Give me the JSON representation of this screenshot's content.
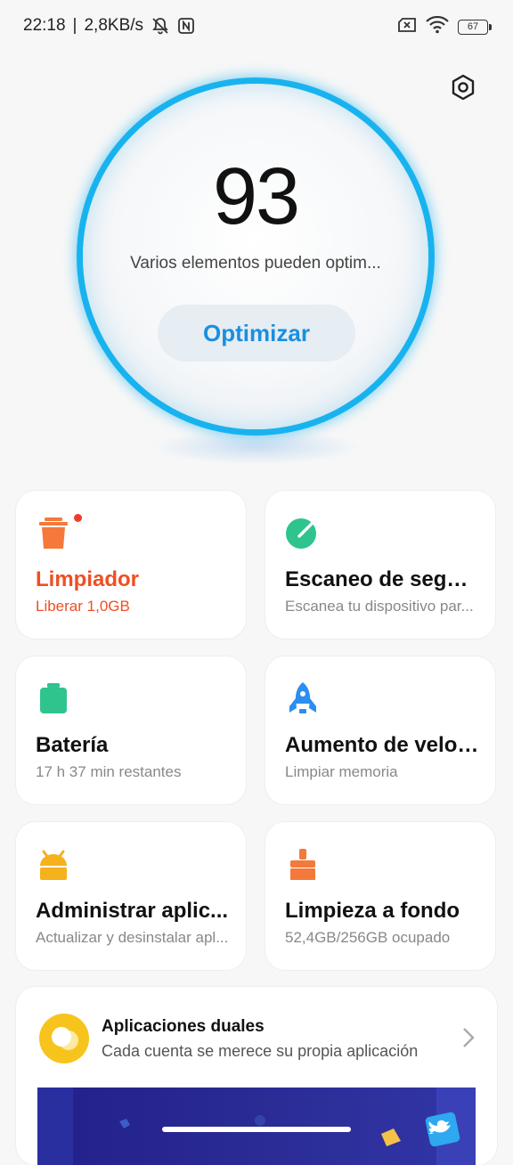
{
  "status_bar": {
    "time": "22:18",
    "separator": "|",
    "net_speed": "2,8KB/s",
    "battery_level": "67"
  },
  "score": {
    "value": "93",
    "subtitle": "Varios elementos pueden optim...",
    "button_label": "Optimizar"
  },
  "cards": [
    {
      "title": "Limpiador",
      "subtitle": "Liberar 1,0GB",
      "icon": "trash-icon",
      "color": "#f4793b"
    },
    {
      "title": "Escaneo de segur...",
      "subtitle": "Escanea tu dispositivo par...",
      "icon": "shield-scan-icon",
      "color": "#2fc48d"
    },
    {
      "title": "Batería",
      "subtitle": "17 h 37 min  restantes",
      "icon": "battery-icon",
      "color": "#2fc48d"
    },
    {
      "title": "Aumento de veloc...",
      "subtitle": "Limpiar memoria",
      "icon": "rocket-icon",
      "color": "#2b8ef0"
    },
    {
      "title": "Administrar aplic...",
      "subtitle": "Actualizar y desinstalar apl...",
      "icon": "android-app-icon",
      "color": "#f6b21c"
    },
    {
      "title": "Limpieza a fondo",
      "subtitle": "52,4GB/256GB ocupado",
      "icon": "brush-icon",
      "color": "#f4793b"
    }
  ],
  "dual_apps": {
    "title": "Aplicaciones duales",
    "subtitle": "Cada cuenta se merece su propia aplicación"
  },
  "colors": {
    "accent": "#1a8fe0",
    "ring": "#18b3ee",
    "alert": "#f04e23"
  }
}
